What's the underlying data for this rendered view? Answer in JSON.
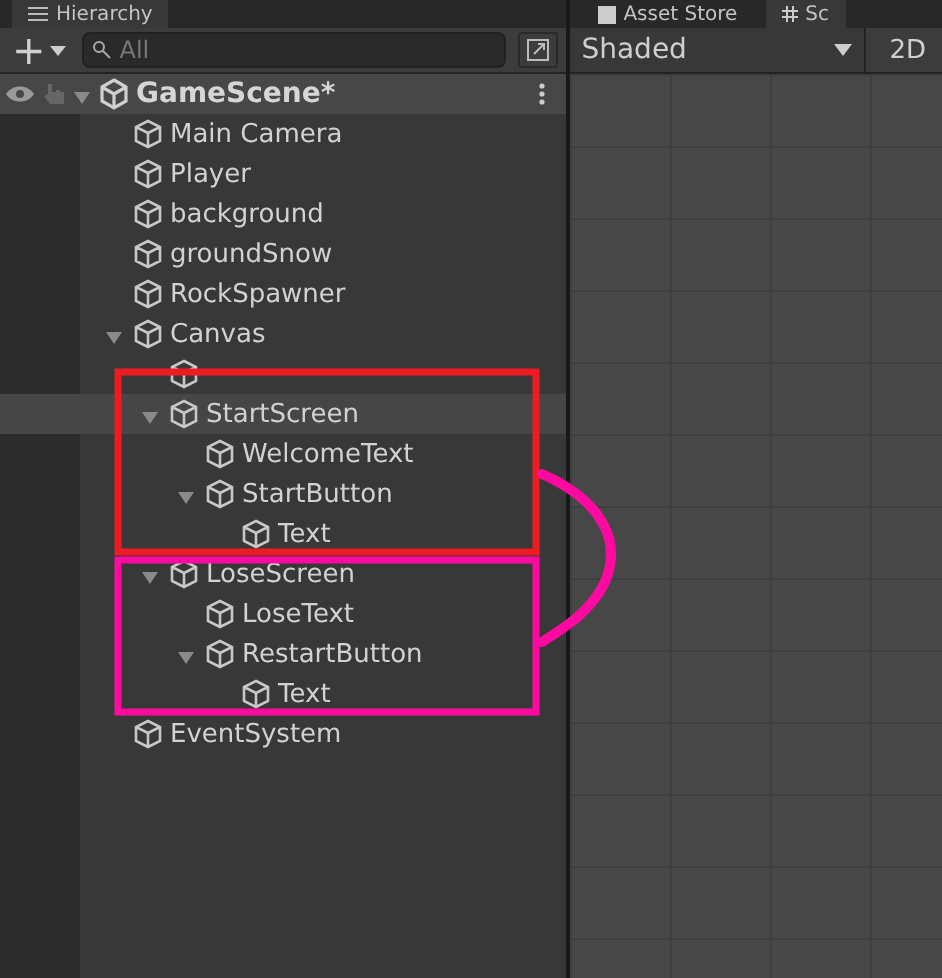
{
  "hierarchy": {
    "tab": "Hierarchy",
    "add_button": "+",
    "search": {
      "placeholder": "All"
    },
    "scene": {
      "name": "GameScene*",
      "expanded": true
    },
    "items": [
      {
        "name": "Main Camera",
        "selected": false
      },
      {
        "name": "Player",
        "selected": false
      },
      {
        "name": "background",
        "selected": false
      },
      {
        "name": "groundSnow",
        "selected": false
      },
      {
        "name": "RockSpawner",
        "selected": false
      },
      {
        "name": "Canvas",
        "selected": false,
        "expanded": true,
        "children": [
          {
            "selected": false
          },
          {
            "name": "StartScreen",
            "selected": true,
            "expanded": true,
            "children": [
              {
                "name": "WelcomeText",
                "selected": false
              },
              {
                "name": "StartButton",
                "selected": false,
                "expanded": true,
                "children": [
                  {
                    "name": "Text",
                    "selected": false
                  }
                ]
              }
            ]
          },
          {
            "name": "LoseScreen",
            "selected": false,
            "expanded": true,
            "children": [
              {
                "name": "LoseText",
                "selected": false
              },
              {
                "name": "RestartButton",
                "selected": false,
                "expanded": true,
                "children": [
                  {
                    "name": "Text",
                    "selected": false
                  }
                ]
              }
            ]
          }
        ]
      },
      {
        "name": "EventSystem",
        "selected": false
      }
    ]
  },
  "scene_view": {
    "tabs": [
      {
        "label": "Asset Store"
      },
      {
        "label": "Sc"
      }
    ],
    "shading": "Shaded",
    "mode_button": "2D"
  },
  "annotations": [
    {
      "kind": "rectangle",
      "color": "#ed1c24"
    },
    {
      "kind": "rectangle",
      "color": "#ff0aa0"
    },
    {
      "kind": "curve",
      "color": "#ff0aa0"
    }
  ]
}
